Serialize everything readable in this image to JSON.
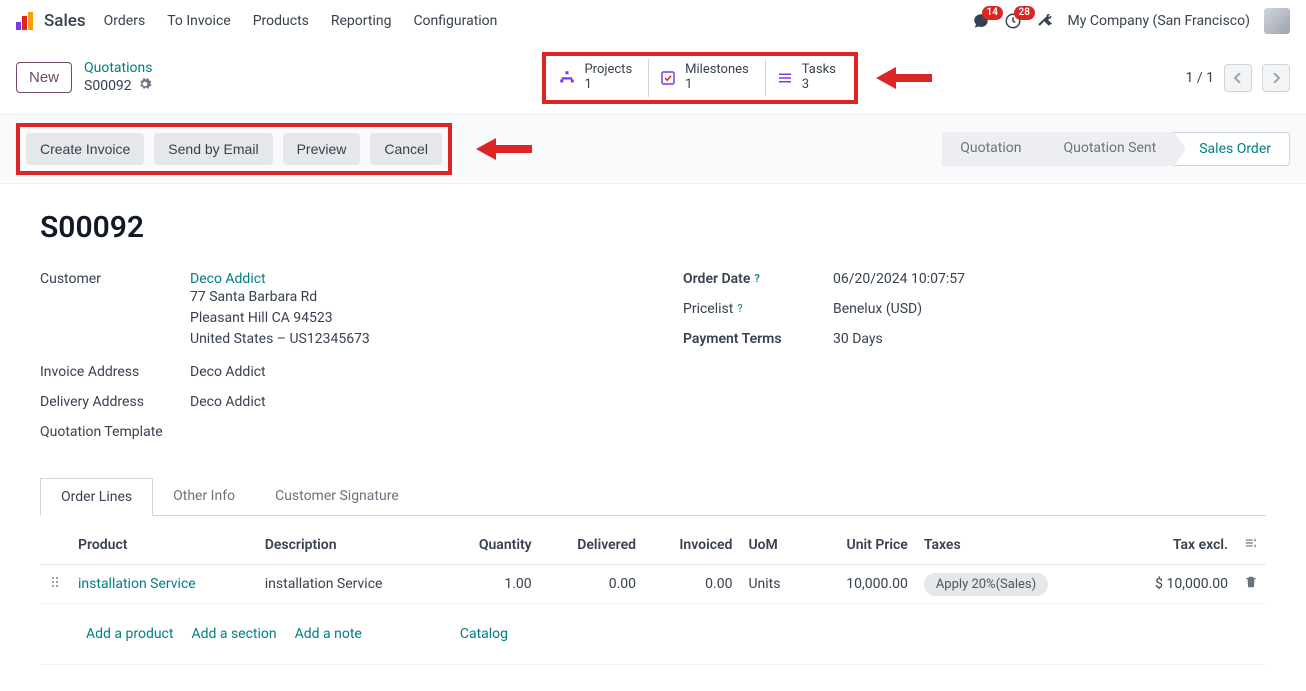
{
  "nav": {
    "app": "Sales",
    "menus": [
      "Orders",
      "To Invoice",
      "Products",
      "Reporting",
      "Configuration"
    ],
    "msg_badge": "14",
    "act_badge": "28",
    "company": "My Company (San Francisco)"
  },
  "breadcrumb": {
    "new": "New",
    "parent": "Quotations",
    "current": "S00092"
  },
  "stats": {
    "projects": {
      "label": "Projects",
      "value": "1"
    },
    "milestones": {
      "label": "Milestones",
      "value": "1"
    },
    "tasks": {
      "label": "Tasks",
      "value": "3"
    }
  },
  "pager": {
    "text": "1 / 1"
  },
  "actions": {
    "create_invoice": "Create Invoice",
    "send_email": "Send by Email",
    "preview": "Preview",
    "cancel": "Cancel"
  },
  "status": {
    "s1": "Quotation",
    "s2": "Quotation Sent",
    "s3": "Sales Order"
  },
  "order": {
    "name": "S00092",
    "customer_label": "Customer",
    "customer": "Deco Addict",
    "address_line1": "77 Santa Barbara Rd",
    "address_line2": "Pleasant Hill CA 94523",
    "address_line3": "United States – US12345673",
    "invoice_address_label": "Invoice Address",
    "invoice_address": "Deco Addict",
    "delivery_address_label": "Delivery Address",
    "delivery_address": "Deco Addict",
    "quotation_template_label": "Quotation Template",
    "order_date_label": "Order Date",
    "order_date": "06/20/2024 10:07:57",
    "pricelist_label": "Pricelist",
    "pricelist": "Benelux (USD)",
    "payment_terms_label": "Payment Terms",
    "payment_terms": "30 Days"
  },
  "tabs": {
    "t1": "Order Lines",
    "t2": "Other Info",
    "t3": "Customer Signature"
  },
  "table": {
    "headers": {
      "product": "Product",
      "description": "Description",
      "quantity": "Quantity",
      "delivered": "Delivered",
      "invoiced": "Invoiced",
      "uom": "UoM",
      "unit_price": "Unit Price",
      "taxes": "Taxes",
      "tax_excl": "Tax excl."
    },
    "row": {
      "product": "installation Service",
      "description": "installation Service",
      "quantity": "1.00",
      "delivered": "0.00",
      "invoiced": "0.00",
      "uom": "Units",
      "unit_price": "10,000.00",
      "tax": "Apply 20%(Sales)",
      "tax_excl": "$ 10,000.00"
    },
    "footer": {
      "add_product": "Add a product",
      "add_section": "Add a section",
      "add_note": "Add a note",
      "catalog": "Catalog"
    }
  }
}
